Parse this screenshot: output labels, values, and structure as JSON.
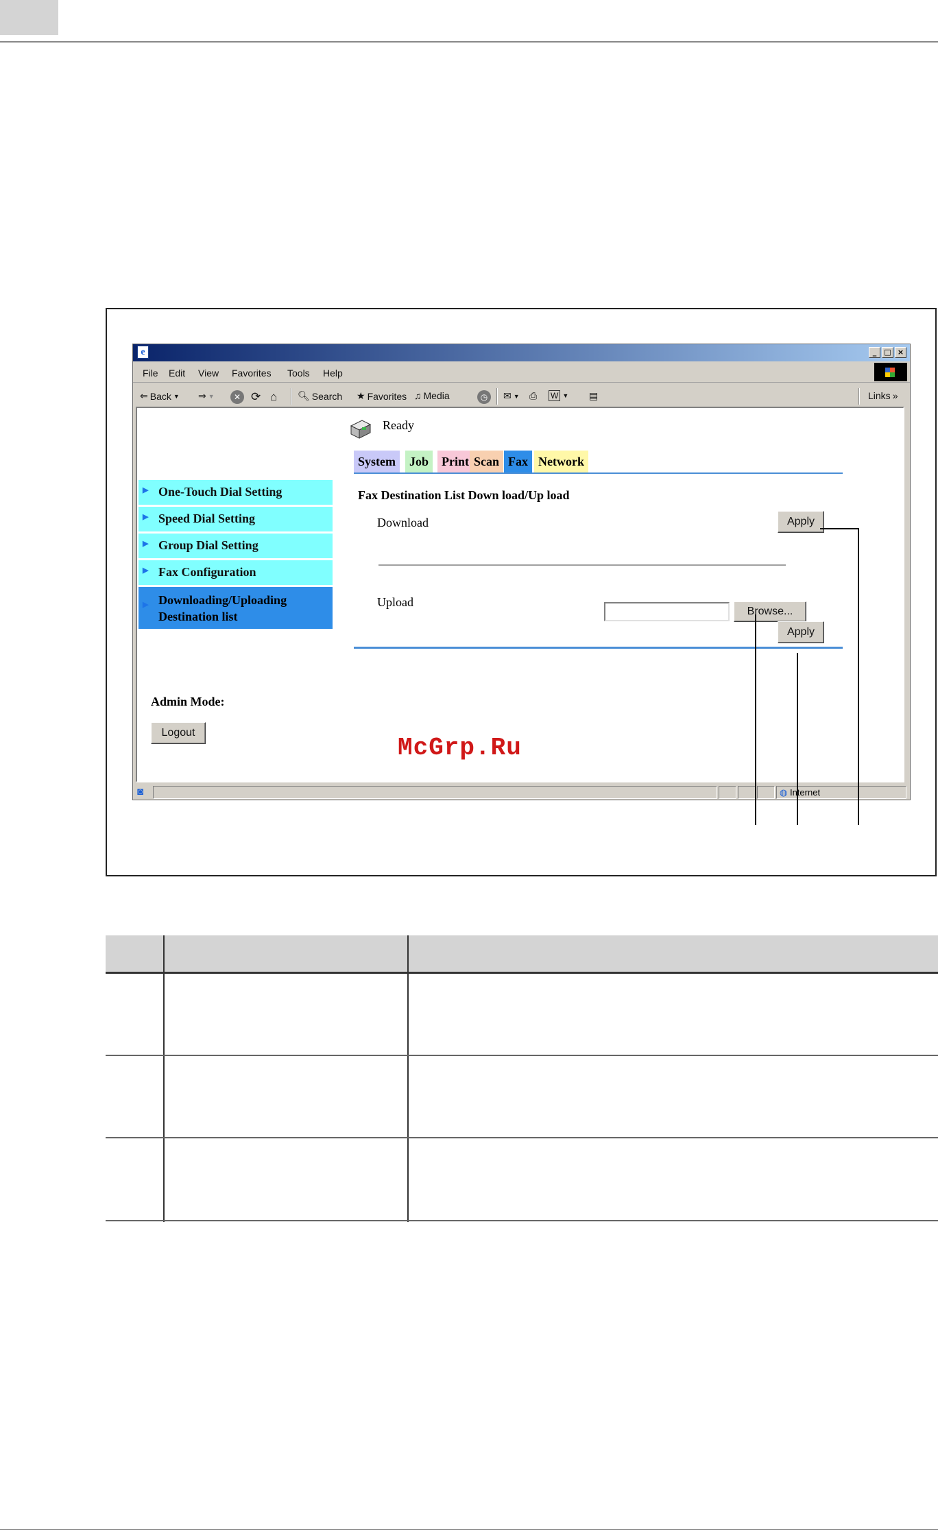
{
  "browser": {
    "menu": [
      "File",
      "Edit",
      "View",
      "Favorites",
      "Tools",
      "Help"
    ],
    "toolbar": {
      "back": "Back",
      "search": "Search",
      "favorites": "Favorites",
      "media": "Media",
      "links": "Links"
    },
    "status_zone": "Internet"
  },
  "page": {
    "status": "Ready",
    "tabs": [
      {
        "label": "System",
        "color": "#c9c9f8"
      },
      {
        "label": "Job",
        "color": "#c4f2c4"
      },
      {
        "label": "Print",
        "color": "#f8c8d8"
      },
      {
        "label": "Scan",
        "color": "#f8d0b0"
      },
      {
        "label": "Fax",
        "color": "#2e8de8"
      },
      {
        "label": "Network",
        "color": "#fff8a8"
      }
    ],
    "sidebar": [
      "One-Touch Dial Setting",
      "Speed Dial Setting",
      "Group Dial Setting",
      "Fax Configuration",
      "Downloading/Uploading Destination list"
    ],
    "content_title": "Fax Destination List Down load/Up load",
    "download_label": "Download",
    "upload_label": "Upload",
    "apply_label": "Apply",
    "browse_label": "Browse...",
    "admin_mode_label": "Admin Mode:",
    "logout_label": "Logout"
  },
  "watermark": "McGrp.Ru"
}
